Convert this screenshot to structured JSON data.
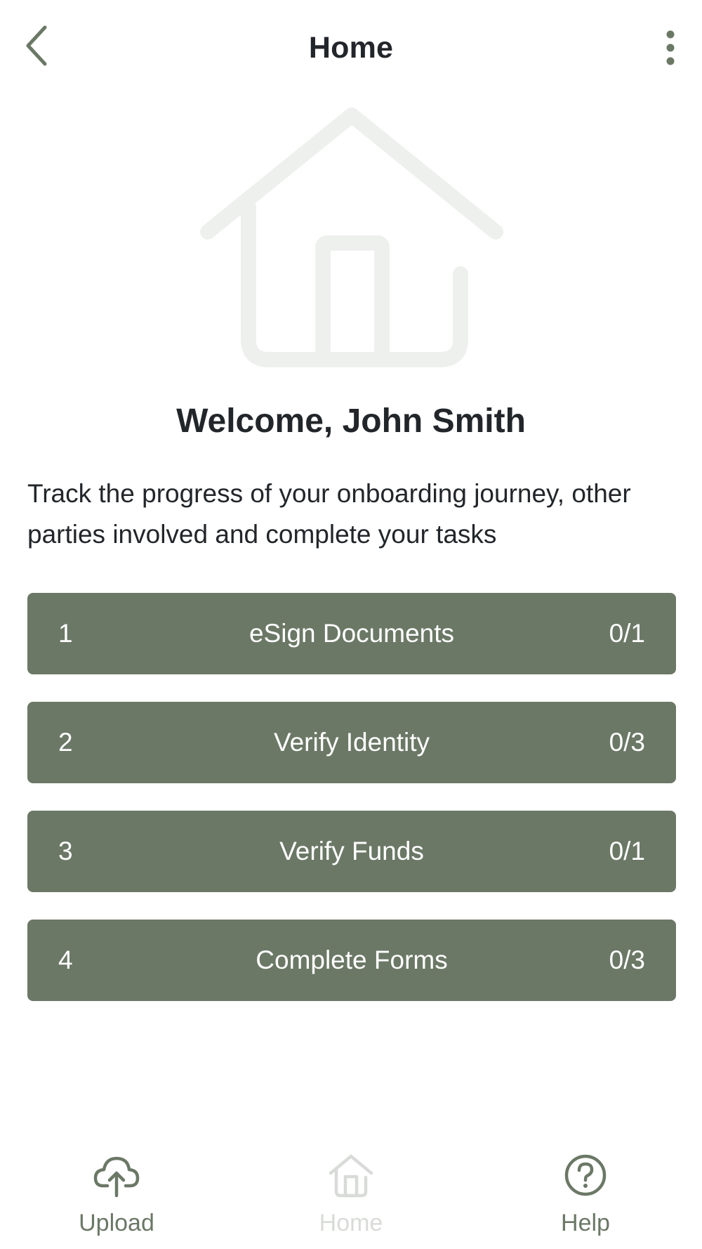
{
  "header": {
    "title": "Home",
    "back_icon": "chevron-left-icon",
    "menu_icon": "more-vertical-icon"
  },
  "hero": {
    "icon": "house-illustration"
  },
  "welcome": "Welcome, John Smith",
  "description": "Track the progress of your onboarding journey, other parties involved and complete your tasks",
  "tasks": [
    {
      "number": "1",
      "label": "eSign Documents",
      "count": "0/1"
    },
    {
      "number": "2",
      "label": "Verify Identity",
      "count": "0/3"
    },
    {
      "number": "3",
      "label": "Verify Funds",
      "count": "0/1"
    },
    {
      "number": "4",
      "label": "Complete Forms",
      "count": "0/3"
    }
  ],
  "bottom_nav": {
    "items": [
      {
        "label": "Upload",
        "icon": "cloud-upload-icon",
        "active": true
      },
      {
        "label": "Home",
        "icon": "home-icon",
        "active": false
      },
      {
        "label": "Help",
        "icon": "help-circle-icon",
        "active": true
      }
    ]
  },
  "colors": {
    "accent": "#6b7866",
    "text": "#22262a",
    "illustration": "#eef0ee",
    "disabled": "#d8dbd7",
    "background": "#ffffff"
  }
}
